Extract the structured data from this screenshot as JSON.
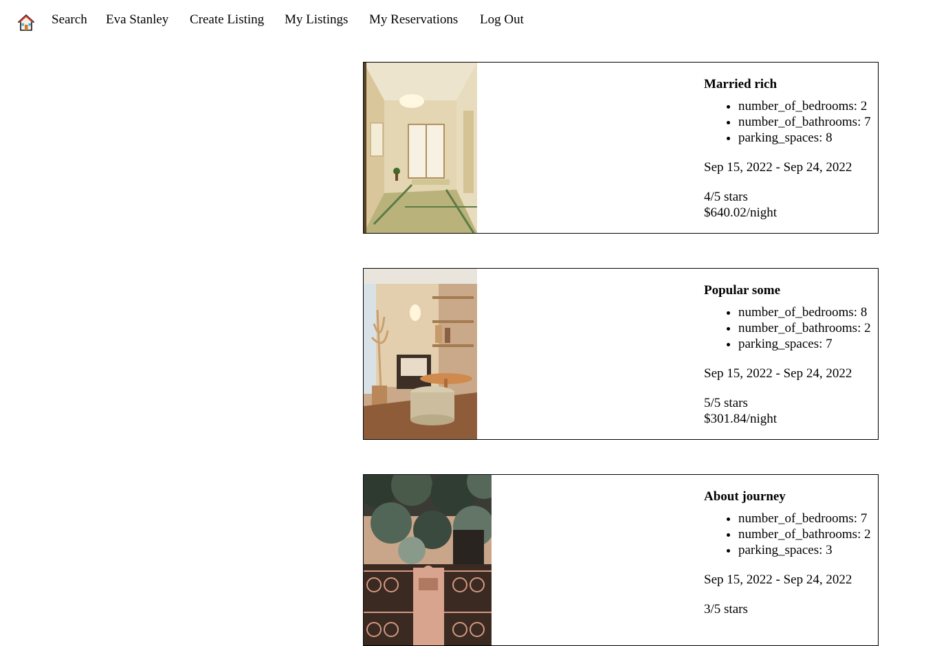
{
  "nav": {
    "home_icon": "house-icon",
    "links": [
      "Search",
      "Eva Stanley",
      "Create Listing",
      "My Listings",
      "My Reservations",
      "Log Out"
    ]
  },
  "listings": [
    {
      "title": "Married rich",
      "features": [
        "number_of_bedrooms: 2",
        "number_of_bathrooms: 7",
        "parking_spaces: 8"
      ],
      "dates": "Sep 15, 2022 - Sep 24, 2022",
      "rating": "4/5 stars",
      "price": "$640.02/night"
    },
    {
      "title": "Popular some",
      "features": [
        "number_of_bedrooms: 8",
        "number_of_bathrooms: 2",
        "parking_spaces: 7"
      ],
      "dates": "Sep 15, 2022 - Sep 24, 2022",
      "rating": "5/5 stars",
      "price": "$301.84/night"
    },
    {
      "title": "About journey",
      "features": [
        "number_of_bedrooms: 7",
        "number_of_bathrooms: 2",
        "parking_spaces: 3"
      ],
      "dates": "Sep 15, 2022 - Sep 24, 2022",
      "rating": "3/5 stars",
      "price": ""
    }
  ]
}
